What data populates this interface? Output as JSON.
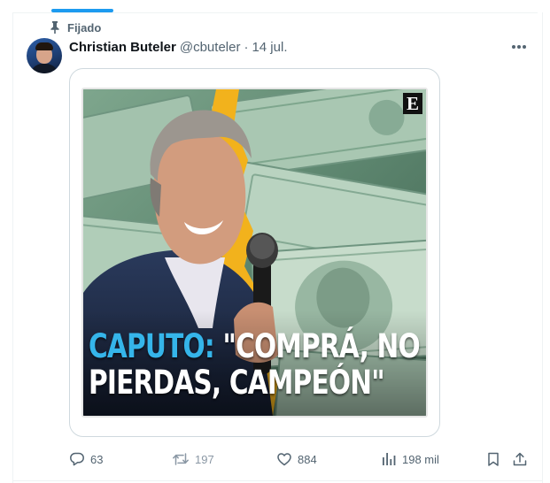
{
  "pinned": {
    "label": "Fijado",
    "icon": "pin-icon"
  },
  "post": {
    "author_name": "Christian Buteler",
    "author_handle": "@cbuteler",
    "separator": "·",
    "date": "14 jul.",
    "more_icon": "more-horizontal-icon"
  },
  "media": {
    "caption_accent": "CAPUTO:",
    "caption_line_1_rest": " \"COMPRÁ, NO TE LA",
    "caption_line_2": "PIERDAS, CAMPEÓN\"",
    "brand_mark": "E",
    "description_icons": [
      "dollar-bills",
      "microphone"
    ]
  },
  "actions": {
    "replies": "63",
    "reposts": "197",
    "likes": "884",
    "views": "198 mil",
    "reply_icon": "reply-icon",
    "repost_icon": "repost-icon",
    "like_icon": "heart-icon",
    "views_icon": "views-icon",
    "bookmark_icon": "bookmark-icon",
    "share_icon": "share-icon"
  },
  "colors": {
    "accent_blue": "#1d9bf0",
    "caption_accent": "#35b5ea",
    "muted_text": "#536471",
    "divider": "#cfd9de"
  }
}
